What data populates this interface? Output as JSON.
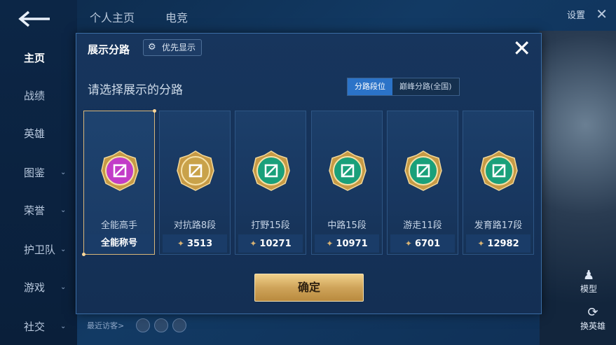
{
  "nav": {
    "tabs": [
      "个人主页",
      "电竞"
    ],
    "settings": "设置",
    "sidebar": [
      {
        "label": "主页",
        "active": true
      },
      {
        "label": "战绩"
      },
      {
        "label": "英雄"
      },
      {
        "label": "图鉴",
        "chevron": true
      },
      {
        "label": "荣誉",
        "chevron": true
      },
      {
        "label": "护卫队",
        "chevron": true
      },
      {
        "label": "游戏",
        "chevron": true
      },
      {
        "label": "社交",
        "chevron": true
      }
    ],
    "recent_visitors": "最近访客>",
    "right_buttons": [
      "模型",
      "换英雄"
    ]
  },
  "modal": {
    "title": "展示分路",
    "priority_button": "优先显示",
    "subtitle": "请选择展示的分路",
    "segments": [
      {
        "label": "分路段位",
        "active": true
      },
      {
        "label": "巅峰分路(全国)",
        "active": false
      }
    ],
    "cards": [
      {
        "rank": "全能高手",
        "bottom": "全能称号",
        "points": null,
        "icon": "all-round-emblem",
        "color": "#c23cc8",
        "selected": true
      },
      {
        "rank": "对抗路8段",
        "bottom": null,
        "points": "3513",
        "icon": "clash-lane-emblem",
        "color": "#c9a24a",
        "selected": false
      },
      {
        "rank": "打野15段",
        "bottom": null,
        "points": "10271",
        "icon": "jungle-emblem",
        "color": "#1aa07a",
        "selected": false
      },
      {
        "rank": "中路15段",
        "bottom": null,
        "points": "10971",
        "icon": "mid-lane-emblem",
        "color": "#1aa07a",
        "selected": false
      },
      {
        "rank": "游走11段",
        "bottom": null,
        "points": "6701",
        "icon": "roam-emblem",
        "color": "#1aa07a",
        "selected": false
      },
      {
        "rank": "发育路17段",
        "bottom": null,
        "points": "12982",
        "icon": "farm-lane-emblem",
        "color": "#1aa07a",
        "selected": false
      }
    ],
    "confirm": "确定"
  }
}
